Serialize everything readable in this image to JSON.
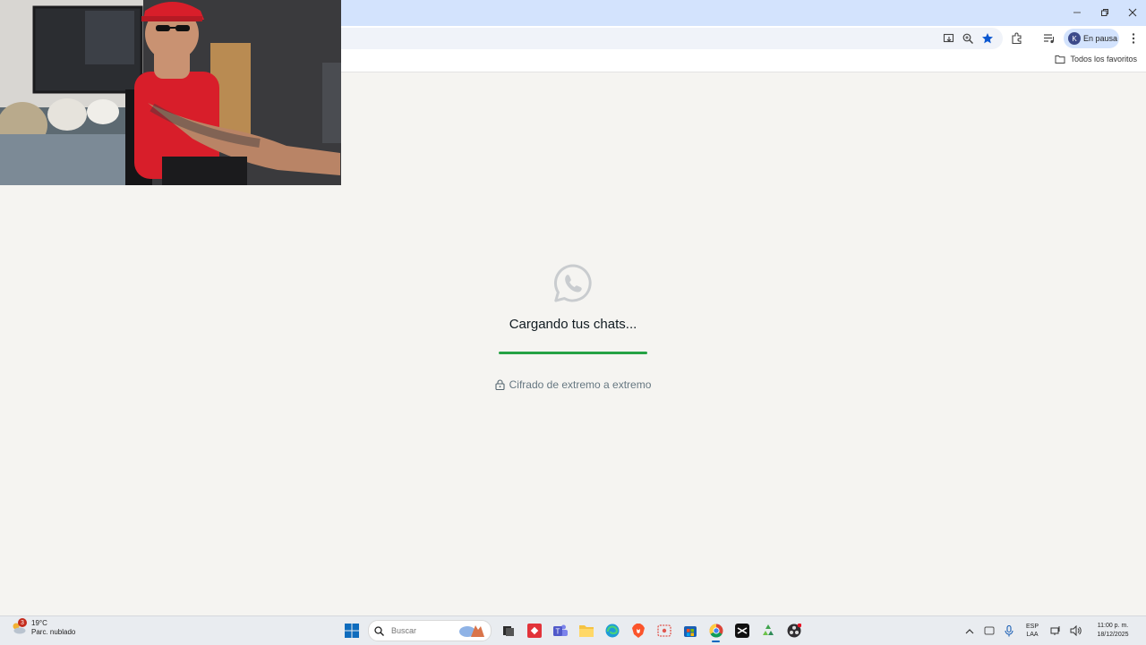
{
  "browser": {
    "profile": {
      "initial": "K",
      "label": "En pausa"
    },
    "bookmarks": {
      "all_label": "Todos los favoritos"
    },
    "toolbar_icons": [
      "install-app-icon",
      "zoom-icon",
      "bookmark-star-icon",
      "extensions-icon",
      "media-controls-icon",
      "more-menu-icon"
    ]
  },
  "loader": {
    "title": "Cargando tus chats...",
    "progress": 1.0,
    "encryption_text": "Cifrado de extremo a extremo"
  },
  "colors": {
    "progress": "#25a244",
    "accent": "#d3e3fd",
    "background": "#f5f4f1"
  },
  "taskbar": {
    "weather": {
      "temp": "19°C",
      "condition": "Parc. nublado",
      "badge": "3"
    },
    "search_placeholder": "Buscar",
    "apps": [
      "start",
      "search",
      "task-view",
      "anydesk",
      "teams",
      "file-explorer",
      "edge",
      "brave",
      "snipping",
      "store",
      "chrome",
      "capcut",
      "recycle",
      "obs"
    ],
    "language": {
      "line1": "ESP",
      "line2": "LAA"
    },
    "clock": {
      "time": "11:00 p. m.",
      "date": "18/12/2025"
    }
  }
}
